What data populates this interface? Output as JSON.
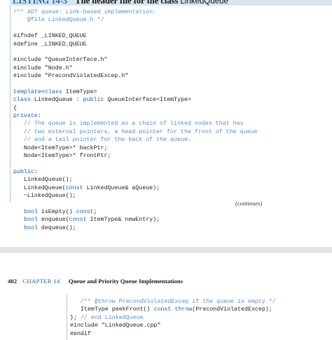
{
  "page1": {
    "listing_label": "LISTING 14-3",
    "listing_title": "The header file for the class",
    "listing_class": "LinkedQueue",
    "code": [
      [
        [
          "cm",
          "/** ADT queue: Link-based implementation."
        ]
      ],
      [
        [
          "cm",
          "    @file LinkedQueue.h */"
        ]
      ],
      [
        [
          "pp",
          ""
        ]
      ],
      [
        [
          "pp",
          "#ifndef _LINKED_QUEUE"
        ]
      ],
      [
        [
          "pp",
          "#define _LINKED_QUEUE"
        ]
      ],
      [
        [
          "pp",
          ""
        ]
      ],
      [
        [
          "pp",
          "#include \"QueueInterface.h\""
        ]
      ],
      [
        [
          "pp",
          "#include \"Node.h\""
        ]
      ],
      [
        [
          "pp",
          "#include \"PrecondViolatedExcep.h\""
        ]
      ],
      [
        [
          "pp",
          ""
        ]
      ],
      [
        [
          "kw",
          "template"
        ],
        [
          "pp",
          "<"
        ],
        [
          "kw",
          "class"
        ],
        [
          "pp",
          " ItemType>"
        ]
      ],
      [
        [
          "kw",
          "class"
        ],
        [
          "pp",
          " LinkedQueue : "
        ],
        [
          "kw",
          "public"
        ],
        [
          "pp",
          " QueueInterface<ItemType>"
        ]
      ],
      [
        [
          "pp",
          "{"
        ]
      ],
      [
        [
          "kw",
          "private"
        ],
        [
          "pp",
          ":"
        ]
      ],
      [
        [
          "cm",
          "   // The queue is implemented as a chain of linked nodes that has"
        ]
      ],
      [
        [
          "cm",
          "   // two external pointers, a head pointer for the front of the queue"
        ]
      ],
      [
        [
          "cm",
          "   // and a tail pointer for the back of the queue."
        ]
      ],
      [
        [
          "pp",
          "   Node<ItemType>* backPtr;"
        ]
      ],
      [
        [
          "pp",
          "   Node<ItemType>* frontPtr;"
        ]
      ],
      [
        [
          "pp",
          ""
        ]
      ],
      [
        [
          "kw",
          "public"
        ],
        [
          "pp",
          ":"
        ]
      ],
      [
        [
          "pp",
          "   LinkedQueue();"
        ]
      ],
      [
        [
          "pp",
          "   LinkedQueue("
        ],
        [
          "kw",
          "const"
        ],
        [
          "pp",
          " LinkedQueue& aQueue);"
        ]
      ],
      [
        [
          "pp",
          "   ~LinkedQueue();"
        ]
      ],
      [
        [
          "pp",
          ""
        ]
      ],
      [
        [
          "pp",
          "   "
        ],
        [
          "kw",
          "bool"
        ],
        [
          "pp",
          " isEmpty() "
        ],
        [
          "kw",
          "const"
        ],
        [
          "pp",
          ";"
        ]
      ],
      [
        [
          "pp",
          "   "
        ],
        [
          "kw",
          "bool"
        ],
        [
          "pp",
          " enqueue("
        ],
        [
          "kw",
          "const"
        ],
        [
          "pp",
          " ItemType& newEntry);"
        ]
      ],
      [
        [
          "pp",
          "   "
        ],
        [
          "kw",
          "bool"
        ],
        [
          "pp",
          " dequeue();"
        ]
      ]
    ],
    "continues": "(continues)"
  },
  "page2": {
    "page_number": "402",
    "chapter": "CHAPTER 14",
    "running_title": "Queue and Priority Queue Implementations",
    "code": [
      [
        [
          "cm",
          "   /** @throw PrecondViolatedExcep if the queue is empty */"
        ]
      ],
      [
        [
          "pp",
          "   ItemType peekFront() "
        ],
        [
          "kw",
          "const"
        ],
        [
          "pp",
          " "
        ],
        [
          "kw",
          "throw"
        ],
        [
          "pp",
          "(PrecondViolatedExcep);"
        ]
      ],
      [
        [
          "pp",
          "}; "
        ],
        [
          "cm",
          "// end LinkedQueue"
        ]
      ],
      [
        [
          "pp",
          "#include \"LinkedQueue.cpp\""
        ]
      ],
      [
        [
          "pp",
          "#endif"
        ]
      ]
    ]
  }
}
